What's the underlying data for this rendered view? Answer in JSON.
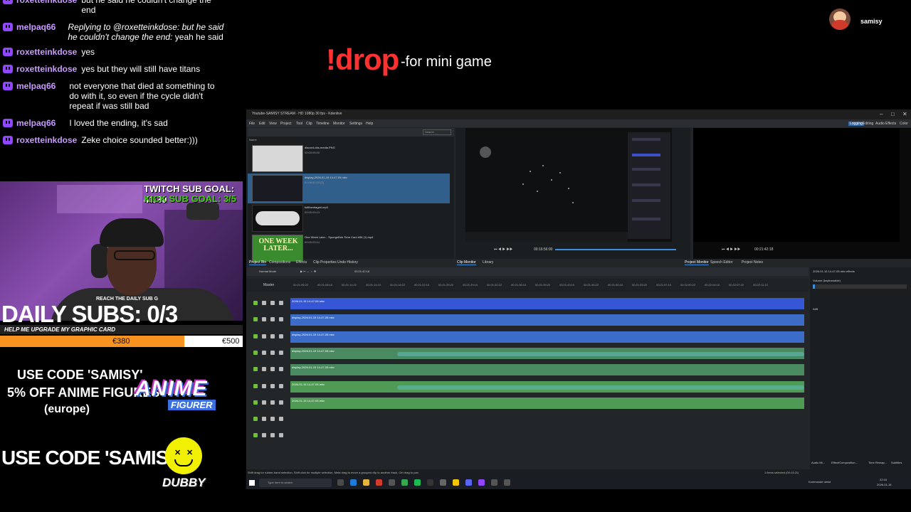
{
  "chat": {
    "messages": [
      {
        "user": "roxetteinkdose",
        "text": "but he said he couldn't change the end"
      },
      {
        "user": "melpaq66",
        "reply": "Replying to @roxetteinkdose: but he said he couldn't change the end:",
        "text": "yeah he said"
      },
      {
        "user": "roxetteinkdose",
        "text": "yes"
      },
      {
        "user": "roxetteinkdose",
        "text": "yes but they will still have titans"
      },
      {
        "user": "melpaq66",
        "text": "not everyone that died at something to do with it, so even if the cycle didn't repeat if was still bad"
      },
      {
        "user": "melpaq66",
        "text": "I loved the ending, it's sad"
      },
      {
        "user": "roxetteinkdose",
        "text": "Zeke choice sounded better:)))"
      }
    ]
  },
  "overlay": {
    "drop_command": "!drop",
    "drop_desc": "-for mini game",
    "streamer": "samisy",
    "twitch_goal": "TWITCH SUB GOAL: 41/30",
    "kick_goal": "KICK SUB GOAL: 3/5",
    "reach": "REACH THE DAILY SUB G",
    "daily_subs": "DAILY SUBS: 0/3",
    "upgrade_label": "HELP ME UPGRADE MY GRAPHIC CARD",
    "upgrade_current": "€380",
    "upgrade_target": "€500",
    "upgrade_progress": 0.76,
    "code1": "USE CODE 'SAMISY'",
    "off": "5% OFF ANIME FIGURES",
    "region": "(europe)",
    "anime_logo": "ANIME",
    "figurer": "FIGURER",
    "code2": "USE CODE 'SAMISY'",
    "dubby": "DUBBY"
  },
  "kdenlive": {
    "title": "Youtube-SAMISY STREAM · HD 1080p 30 fps - Kdenlive",
    "menu": [
      "File",
      "Edit",
      "View",
      "Project",
      "Tool",
      "Clip",
      "Timeline",
      "Monitor",
      "Settings",
      "Help"
    ],
    "layouts": [
      "Logging",
      "Editing",
      "Audio",
      "Effects",
      "Color"
    ],
    "search_placeholder": "Search",
    "bin_header": "Name",
    "clips": [
      {
        "name": "discord-obs-media.PNG",
        "meta": "00:00:05:00"
      },
      {
        "name": "display-2026-01-15 14-47-05.mkv",
        "meta": "01:09:51:10 [2]"
      },
      {
        "name": "fullthemtagerl.mp3",
        "meta": "00:00:09:13"
      },
      {
        "name": "One Week Later... SpongeBob Time Card #56 (1).mp4",
        "meta": "00:00:03:14"
      }
    ],
    "one_week_later": "ONE WEEK LATER...",
    "bin_tabs": [
      "Project Bin",
      "Compositions",
      "Effects",
      "Clip Properties",
      "Undo History"
    ],
    "monitor_tabs": [
      "Clip Monitor",
      "Library"
    ],
    "project_tabs": [
      "Project Monitor",
      "Speech Editor",
      "Project Notes"
    ],
    "monitor_tc": "00:16:56:00",
    "timeline_mode": "Normal Mode",
    "timeline_tc": "00:21:42:18",
    "ruler_master": "Master",
    "ruler_ticks": [
      "00:21:05:22",
      "00:21:08:10",
      "00:21:11:22",
      "00:21:14:10",
      "00:21:18:22",
      "00:21:22:10",
      "00:21:25:22",
      "00:21:29:10",
      "00:21:32:22",
      "00:21:36:10",
      "00:21:39:22",
      "00:21:43:10",
      "00:21:46:22",
      "00:21:50:10",
      "00:21:53:22",
      "00:21:57:10",
      "00:22:00:22",
      "00:22:04:10",
      "00:22:07:22",
      "00:22:11:10"
    ],
    "tracks": [
      {
        "label": "2026-01-15 14-47-05.mkv",
        "color": "#3557d6",
        "wave": false
      },
      {
        "label": "display-2026-01-15 14-47-05.mkv",
        "color": "#3a6cc8",
        "wave": false
      },
      {
        "label": "display-2026-01-15 14-47-05.mkv",
        "color": "#3a6cc8",
        "wave": false
      },
      {
        "label": "display-2026-01-15 14-47-05.mkv",
        "color": "#4a8a60",
        "wave": true
      },
      {
        "label": "display-2026-01-15 14-47-05.mkv",
        "color": "#4a8a60",
        "wave": false
      },
      {
        "label": "2026-01-15 14-47-05.mkv",
        "color": "#4f9a55",
        "wave": true
      },
      {
        "label": "2026-01-15 14-47-05.mkv",
        "color": "#4f9a55",
        "wave": false
      }
    ],
    "effects_title": "2026-01-15 14-47-05.mkv effects",
    "volume_label": "Volume (keyframable)",
    "volume_db": "0dB",
    "effect_tabs": [
      "Audio Mi...",
      "Effect/Composition...",
      "Time Remap...",
      "Subtitles"
    ],
    "status_hint": "Shift drag for rubber-band selection, Shift click for multiple selection, Meta drag to move a grouped clip to another track, Ctrl drag to pan",
    "status_right": "1 items selected (00:13:21)",
    "taskbar_search": "Type here to search",
    "tray_app": "Kommande ulmst",
    "tray_time": "22:16",
    "tray_date": "2026-01-16"
  }
}
